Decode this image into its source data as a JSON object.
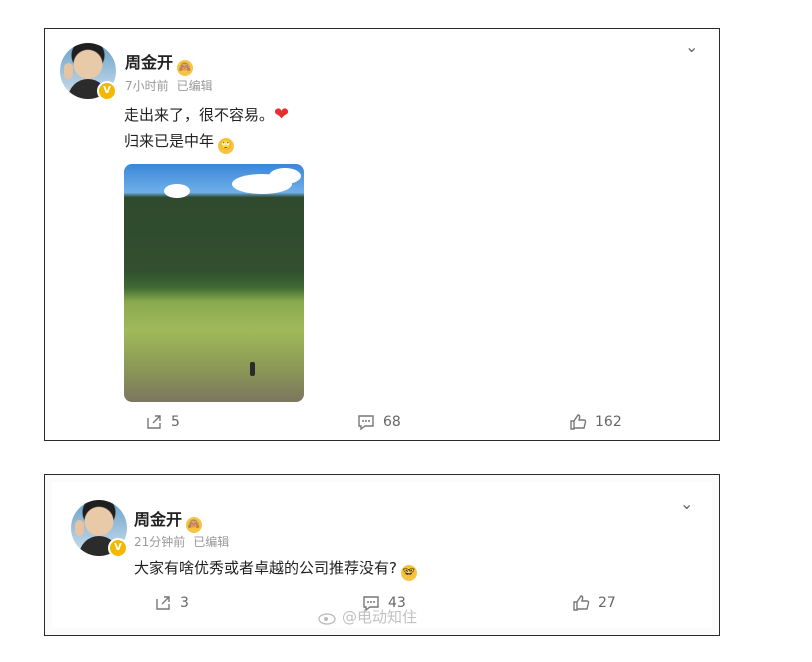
{
  "posts": [
    {
      "author": "周金开",
      "author_emoji": "🙈",
      "time": "7小时前",
      "edited": "已编辑",
      "lines": [
        "走出来了，很不容易。",
        "归来已是中年"
      ],
      "line1_emoji": "❤",
      "line2_emoji": "🙄",
      "has_image": true,
      "stats": {
        "repost": "5",
        "comment": "68",
        "like": "162"
      }
    },
    {
      "author": "周金开",
      "author_emoji": "🙈",
      "time": "21分钟前",
      "edited": "已编辑",
      "lines": [
        "大家有啥优秀或者卓越的公司推荐没有?"
      ],
      "line1_emoji": "🤓",
      "has_image": false,
      "stats": {
        "repost": "3",
        "comment": "43",
        "like": "27"
      }
    }
  ],
  "watermark": "@电动知住",
  "icons": {
    "more": "chevron-down-icon",
    "repost": "share-icon",
    "comment": "comment-icon",
    "like": "thumbs-up-icon",
    "verified": "verified-badge-icon"
  },
  "colors": {
    "badge": "#f5b800",
    "heart": "#e5302f",
    "meta": "#999999"
  }
}
